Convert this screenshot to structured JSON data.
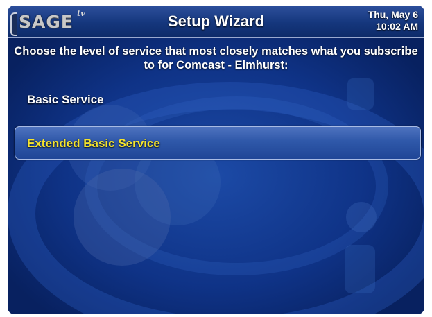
{
  "header": {
    "logo_text": "SAGE",
    "logo_superscript": "tv",
    "title": "Setup Wizard",
    "date": "Thu, May 6",
    "time": "10:02 AM"
  },
  "prompt": "Choose the level of service that most closely matches what you subscribe to for Comcast - Elmhurst:",
  "options": [
    {
      "label": "Basic Service",
      "selected": false
    },
    {
      "label": "Extended Basic Service",
      "selected": true
    }
  ],
  "colors": {
    "background": "#0a2a76",
    "header": "#15377d",
    "selected_text": "#f5e42c",
    "text": "#ffffff"
  }
}
